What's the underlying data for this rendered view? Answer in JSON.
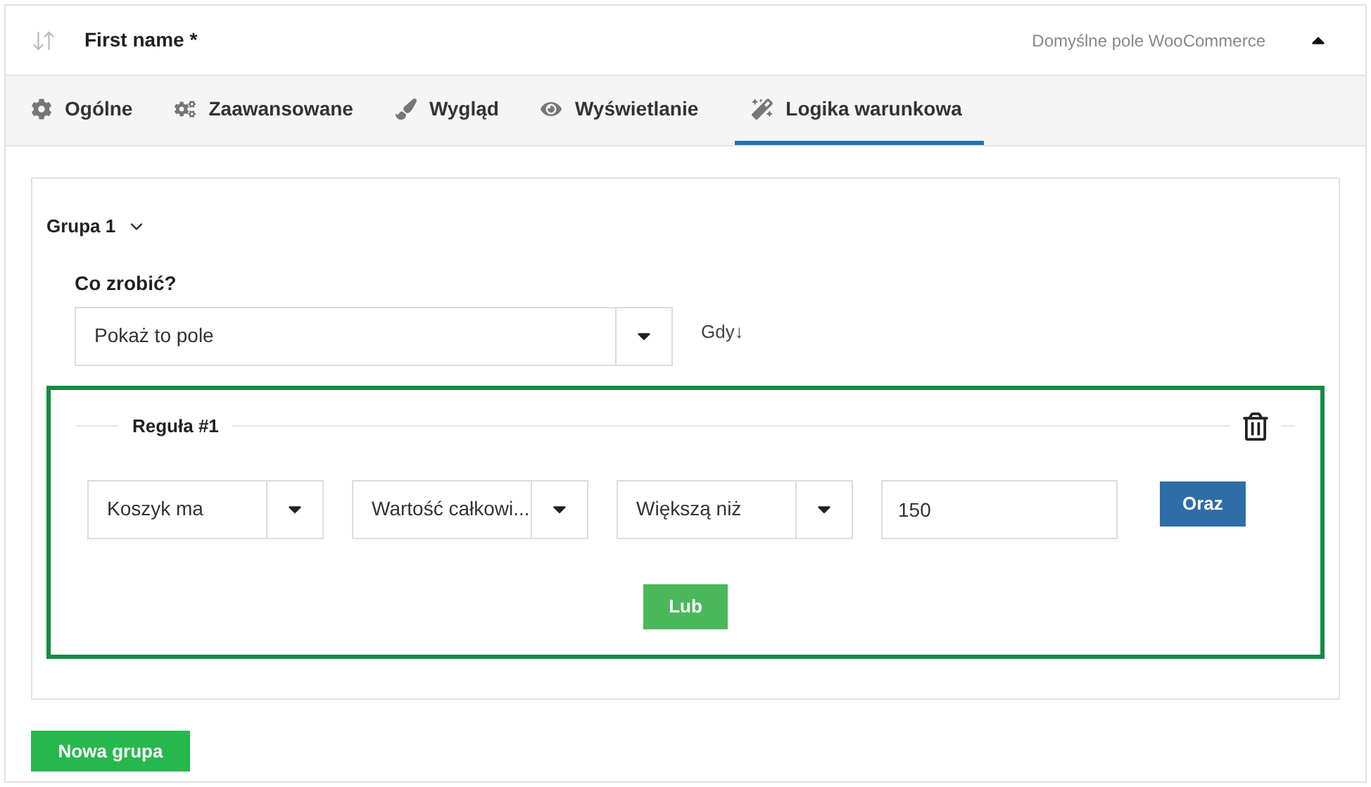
{
  "header": {
    "title": "First name *",
    "note": "Domyślne pole WooCommerce",
    "expanded": true
  },
  "tabs": [
    {
      "label": "Ogólne",
      "selected": false
    },
    {
      "label": "Zaawansowane",
      "selected": false
    },
    {
      "label": "Wygląd",
      "selected": false
    },
    {
      "label": "Wyświetlanie",
      "selected": false
    },
    {
      "label": "Logika warunkowa",
      "selected": true
    }
  ],
  "group": {
    "title": "Grupa 1",
    "action_label": "Co zrobić?",
    "action_value": "Pokaż to pole",
    "when_label": "Gdy↓",
    "rule": {
      "title": "Reguła #1",
      "selects": [
        "Koszyk ma",
        "Wartość całkowi...",
        "Większą niż"
      ],
      "value": "150",
      "and_button": "Oraz",
      "or_button": "Lub"
    }
  },
  "new_group_button": "Nowa grupa"
}
